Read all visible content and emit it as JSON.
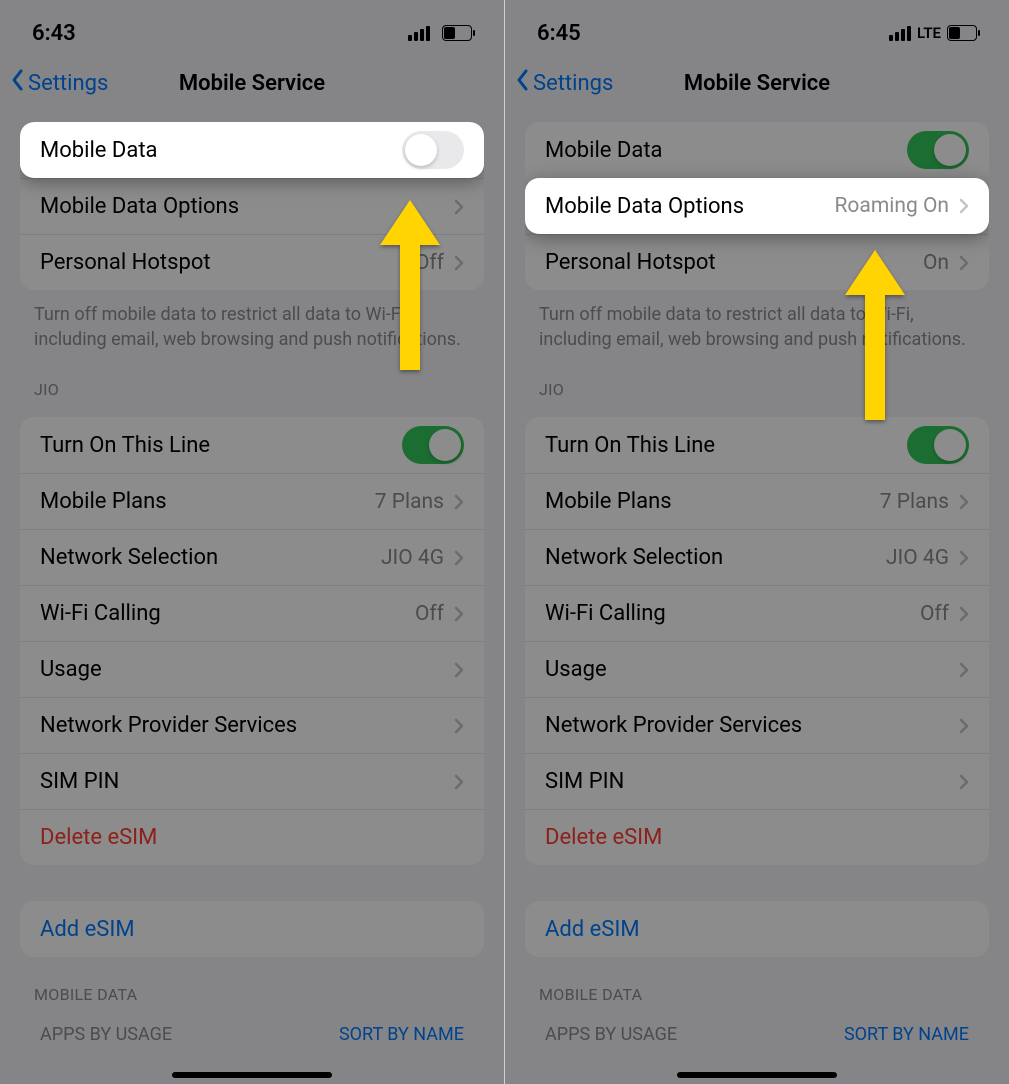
{
  "left": {
    "status": {
      "time": "6:43",
      "lte": ""
    },
    "nav": {
      "back": "Settings",
      "title": "Mobile Service"
    },
    "cell": {
      "mobile_data": "Mobile Data",
      "mobile_data_options": "Mobile Data Options",
      "mobile_data_options_value": "",
      "personal_hotspot": "Personal Hotspot",
      "personal_hotspot_value": "Off"
    },
    "footer": "Turn off mobile data to restrict all data to Wi-Fi, including email, web browsing and push notifications.",
    "carrier_section": "JIO",
    "carrier": {
      "turn_on": "Turn On This Line",
      "plans": "Mobile Plans",
      "plans_value": "7 Plans",
      "net_sel": "Network Selection",
      "net_sel_value": "JIO 4G",
      "wifi_call": "Wi-Fi Calling",
      "wifi_call_value": "Off",
      "usage": "Usage",
      "provider": "Network Provider Services",
      "sim_pin": "SIM PIN",
      "delete_esim": "Delete eSIM"
    },
    "add_esim": "Add eSIM",
    "md_section": "MOBILE DATA",
    "apps_by_usage": "APPS BY USAGE",
    "sort_by_name": "SORT BY NAME"
  },
  "right": {
    "status": {
      "time": "6:45",
      "lte": "LTE"
    },
    "nav": {
      "back": "Settings",
      "title": "Mobile Service"
    },
    "cell": {
      "mobile_data": "Mobile Data",
      "mobile_data_options": "Mobile Data Options",
      "mobile_data_options_value": "Roaming On",
      "personal_hotspot": "Personal Hotspot",
      "personal_hotspot_value": "On"
    },
    "footer": "Turn off mobile data to restrict all data to Wi-Fi, including email, web browsing and push notifications.",
    "carrier_section": "JIO",
    "carrier": {
      "turn_on": "Turn On This Line",
      "plans": "Mobile Plans",
      "plans_value": "7 Plans",
      "net_sel": "Network Selection",
      "net_sel_value": "JIO 4G",
      "wifi_call": "Wi-Fi Calling",
      "wifi_call_value": "Off",
      "usage": "Usage",
      "provider": "Network Provider Services",
      "sim_pin": "SIM PIN",
      "delete_esim": "Delete eSIM"
    },
    "add_esim": "Add eSIM",
    "md_section": "MOBILE DATA",
    "apps_by_usage": "APPS BY USAGE",
    "sort_by_name": "SORT BY NAME"
  }
}
